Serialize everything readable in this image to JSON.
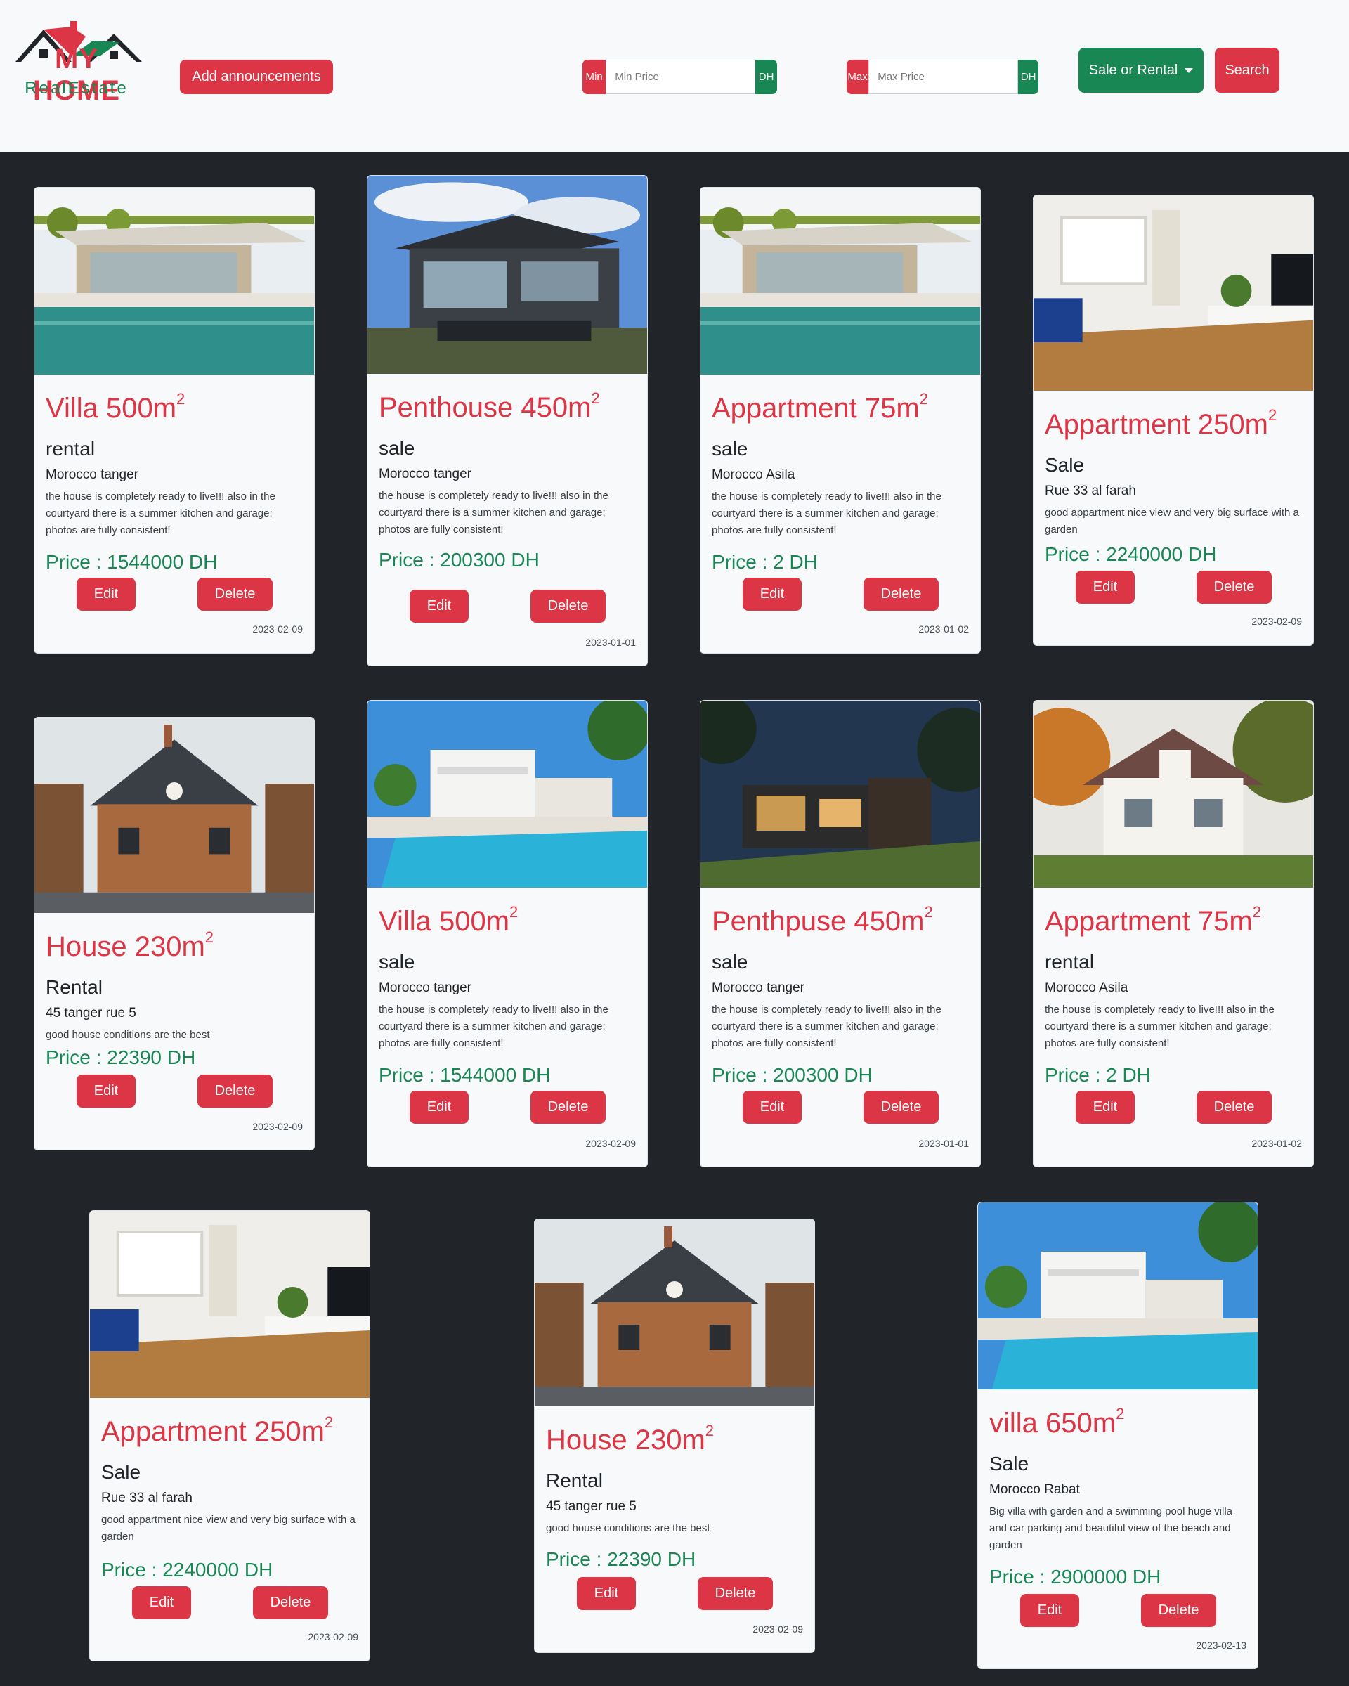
{
  "brand": {
    "title": "MY HOME",
    "subtitle": "RealEstate"
  },
  "header": {
    "add_label": "Add announcements",
    "min_label": "Min",
    "min_placeholder": "Min Price",
    "min_unit": "DH",
    "max_label": "Max",
    "max_placeholder": "Max Price",
    "max_unit": "DH",
    "type_select": "Sale or Rental",
    "search_label": "Search"
  },
  "colors": {
    "brand_red": "#dc3545",
    "brand_green": "#198754",
    "page_bg": "#212529",
    "header_bg": "#f8f9fa"
  },
  "actions": {
    "edit": "Edit",
    "delete": "Delete"
  },
  "listings": [
    {
      "name": "Villa 500m",
      "exp": "2",
      "type": "rental",
      "location": "Morocco tanger",
      "desc": "the house is completely ready to live!!! also in the courtyard there is a summer kitchen and garage; photos are fully consistent!",
      "price": "Price : 1544000 DH",
      "date": "2023-02-09",
      "photo": "villa-pool"
    },
    {
      "name": "Penthouse 450m",
      "exp": "2",
      "type": "sale",
      "location": "Morocco tanger",
      "desc": "the house is completely ready to live!!! also in the courtyard there is a summer kitchen and garage; photos are fully consistent!",
      "price": "Price : 200300 DH",
      "date": "2023-01-01",
      "photo": "modern-house"
    },
    {
      "name": "Appartment 75m",
      "exp": "2",
      "type": "sale",
      "location": "Morocco Asila",
      "desc": "the house is completely ready to live!!! also in the courtyard there is a summer kitchen and garage; photos are fully consistent!",
      "price": "Price : 2 DH",
      "date": "2023-01-02",
      "photo": "villa-pool"
    },
    {
      "name": "Appartment 250m",
      "exp": "2",
      "type": "Sale",
      "location": "Rue 33 al farah",
      "desc": "good appartment nice view and very big surface with a garden",
      "price": "Price : 2240000 DH",
      "date": "2023-02-09",
      "photo": "interior"
    },
    {
      "name": "House 230m",
      "exp": "2",
      "type": "Rental",
      "location": "45 tanger rue 5",
      "desc": "good house conditions are the best",
      "price": "Price : 22390 DH",
      "date": "2023-02-09",
      "photo": "brick-house"
    },
    {
      "name": "Villa 500m",
      "exp": "2",
      "type": "sale",
      "location": "Morocco tanger",
      "desc": "the house is completely ready to live!!! also in the courtyard there is a summer kitchen and garage; photos are fully consistent!",
      "price": "Price : 1544000 DH",
      "date": "2023-02-09",
      "photo": "white-villa-pool"
    },
    {
      "name": "Penthpuse 450m",
      "exp": "2",
      "type": "sale",
      "location": "Morocco tanger",
      "desc": "the house is completely ready to live!!! also in the courtyard there is a summer kitchen and garage; photos are fully consistent!",
      "price": "Price : 200300 DH",
      "date": "2023-01-01",
      "photo": "night-house"
    },
    {
      "name": "Appartment 75m",
      "exp": "2",
      "type": "rental",
      "location": "Morocco Asila",
      "desc": "the house is completely ready to live!!! also in the courtyard there is a summer kitchen and garage; photos are fully consistent!",
      "price": "Price : 2 DH",
      "date": "2023-01-02",
      "photo": "white-cottage"
    },
    {
      "name": "Appartment 250m",
      "exp": "2",
      "type": "Sale",
      "location": "Rue 33 al farah",
      "desc": "good appartment nice view and very big surface with a garden",
      "price": "Price : 2240000 DH",
      "date": "2023-02-09",
      "photo": "interior"
    },
    {
      "name": "House 230m",
      "exp": "2",
      "type": "Rental",
      "location": "45 tanger rue 5",
      "desc": "good house conditions are the best",
      "price": "Price : 22390 DH",
      "date": "2023-02-09",
      "photo": "brick-house"
    },
    {
      "name": "villa 650m",
      "exp": "2",
      "type": "Sale",
      "location": "Morocco Rabat",
      "desc": "Big villa with garden and a swimming pool huge villa and car parking and beautiful view of the beach and garden",
      "price": "Price : 2900000 DH",
      "date": "2023-02-13",
      "photo": "white-villa-pool"
    }
  ]
}
